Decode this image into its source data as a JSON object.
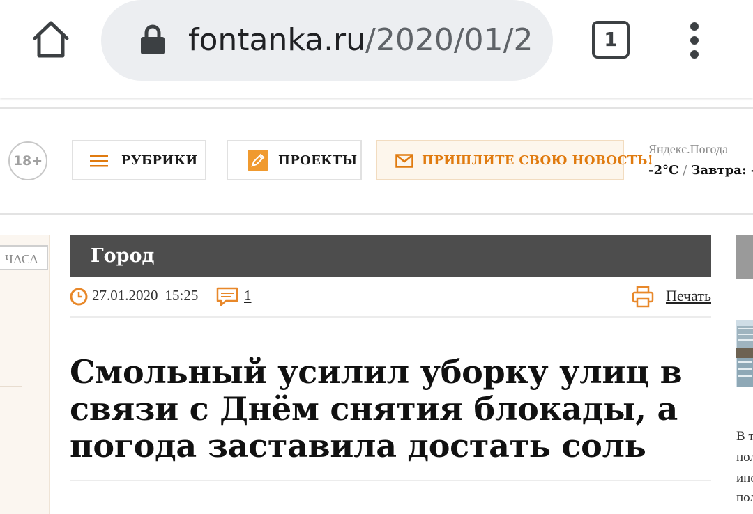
{
  "browser": {
    "url_host": "fontanka.ru",
    "url_path": "/2020/01/2",
    "tab_count": "1"
  },
  "site": {
    "age_rating": "18+",
    "nav": {
      "rubriki_label": "РУБРИКИ",
      "projects_label": "ПРОЕКТЫ",
      "send_news_label": "ПРИШЛИТЕ СВОЮ НОВОСТЬ!"
    },
    "weather": {
      "source": "Яндекс.Погода",
      "temp_now": "-2°C",
      "separator": "/",
      "tomorrow": "Завтра: -"
    },
    "sidebar_tab": "ЧАСА"
  },
  "article": {
    "section": "Город",
    "date": "27.01.2020",
    "time": "15:25",
    "comments": "1",
    "print_label": "Печать",
    "headline": "Смольный усилил уборку улиц в связи с Днём снятия блокады, а погода заставила достать соль"
  },
  "right_column": {
    "text_fragments": [
      "В т",
      "пол",
      "ипс",
      "пол"
    ]
  },
  "colors": {
    "accent_orange": "#e07b10",
    "section_bar": "#4d4d4d",
    "urlbar_bg": "#eceef1"
  }
}
